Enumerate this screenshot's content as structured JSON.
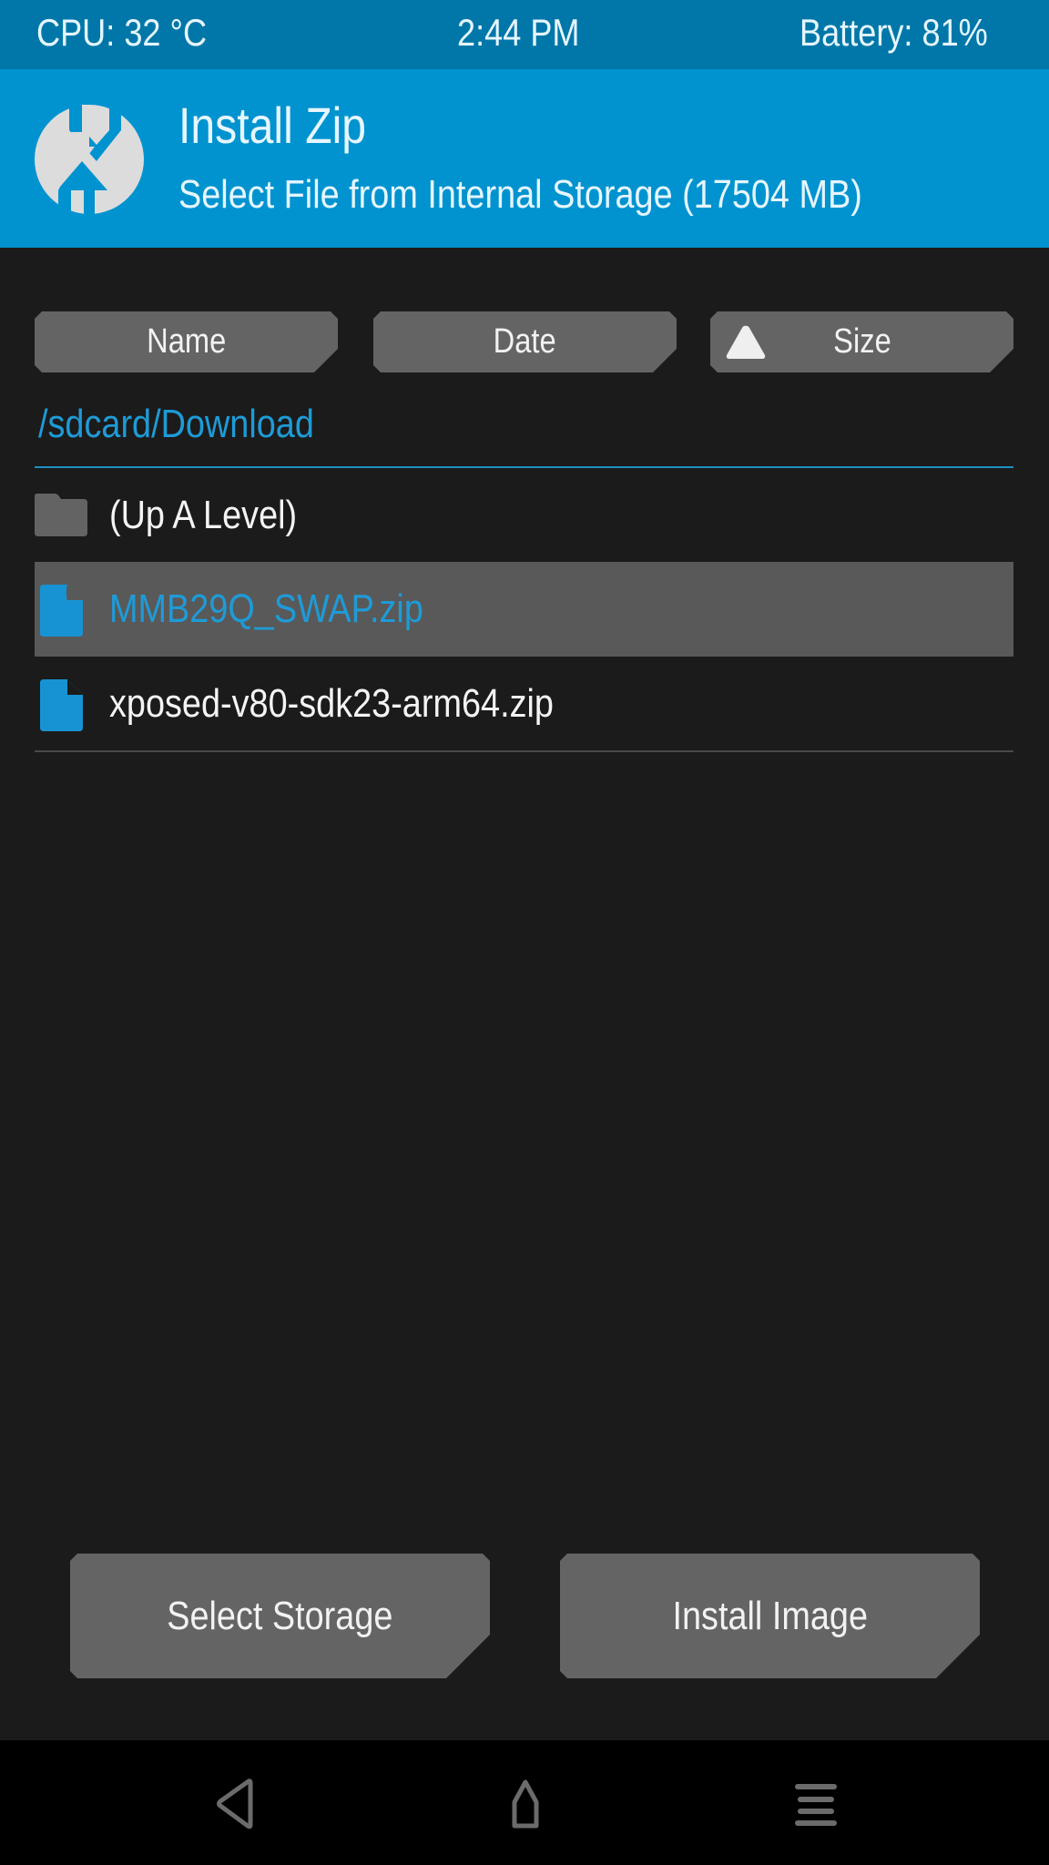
{
  "status_bar": {
    "cpu": "CPU: 32 °C",
    "time": "2:44 PM",
    "battery": "Battery: 81%"
  },
  "header": {
    "logo_icon": "twrp-logo-icon",
    "title": "Install Zip",
    "subtitle": "Select File from Internal Storage (17504 MB)"
  },
  "sort_buttons": [
    {
      "label": "Name",
      "active": false
    },
    {
      "label": "Date",
      "active": false
    },
    {
      "label": "Size",
      "active": true,
      "indicator": "sort-ascending-icon"
    }
  ],
  "current_path": "/sdcard/Download",
  "files": [
    {
      "name": "(Up A Level)",
      "type": "folder",
      "icon": "folder-icon",
      "selected": false
    },
    {
      "name": "MMB29Q_SWAP.zip",
      "type": "file",
      "icon": "file-icon",
      "selected": true
    },
    {
      "name": "xposed-v80-sdk23-arm64.zip",
      "type": "file",
      "icon": "file-icon",
      "selected": false
    }
  ],
  "actions": {
    "select_storage": "Select Storage",
    "install_image": "Install Image"
  },
  "nav": {
    "back": "back-icon",
    "home": "home-icon",
    "menu": "menu-icon"
  },
  "colors": {
    "status_bar": "#0077a8",
    "header": "#0093cf",
    "accent": "#1e9bd7",
    "background": "#1b1b1b",
    "button": "#646464",
    "selected_row": "#595959"
  }
}
